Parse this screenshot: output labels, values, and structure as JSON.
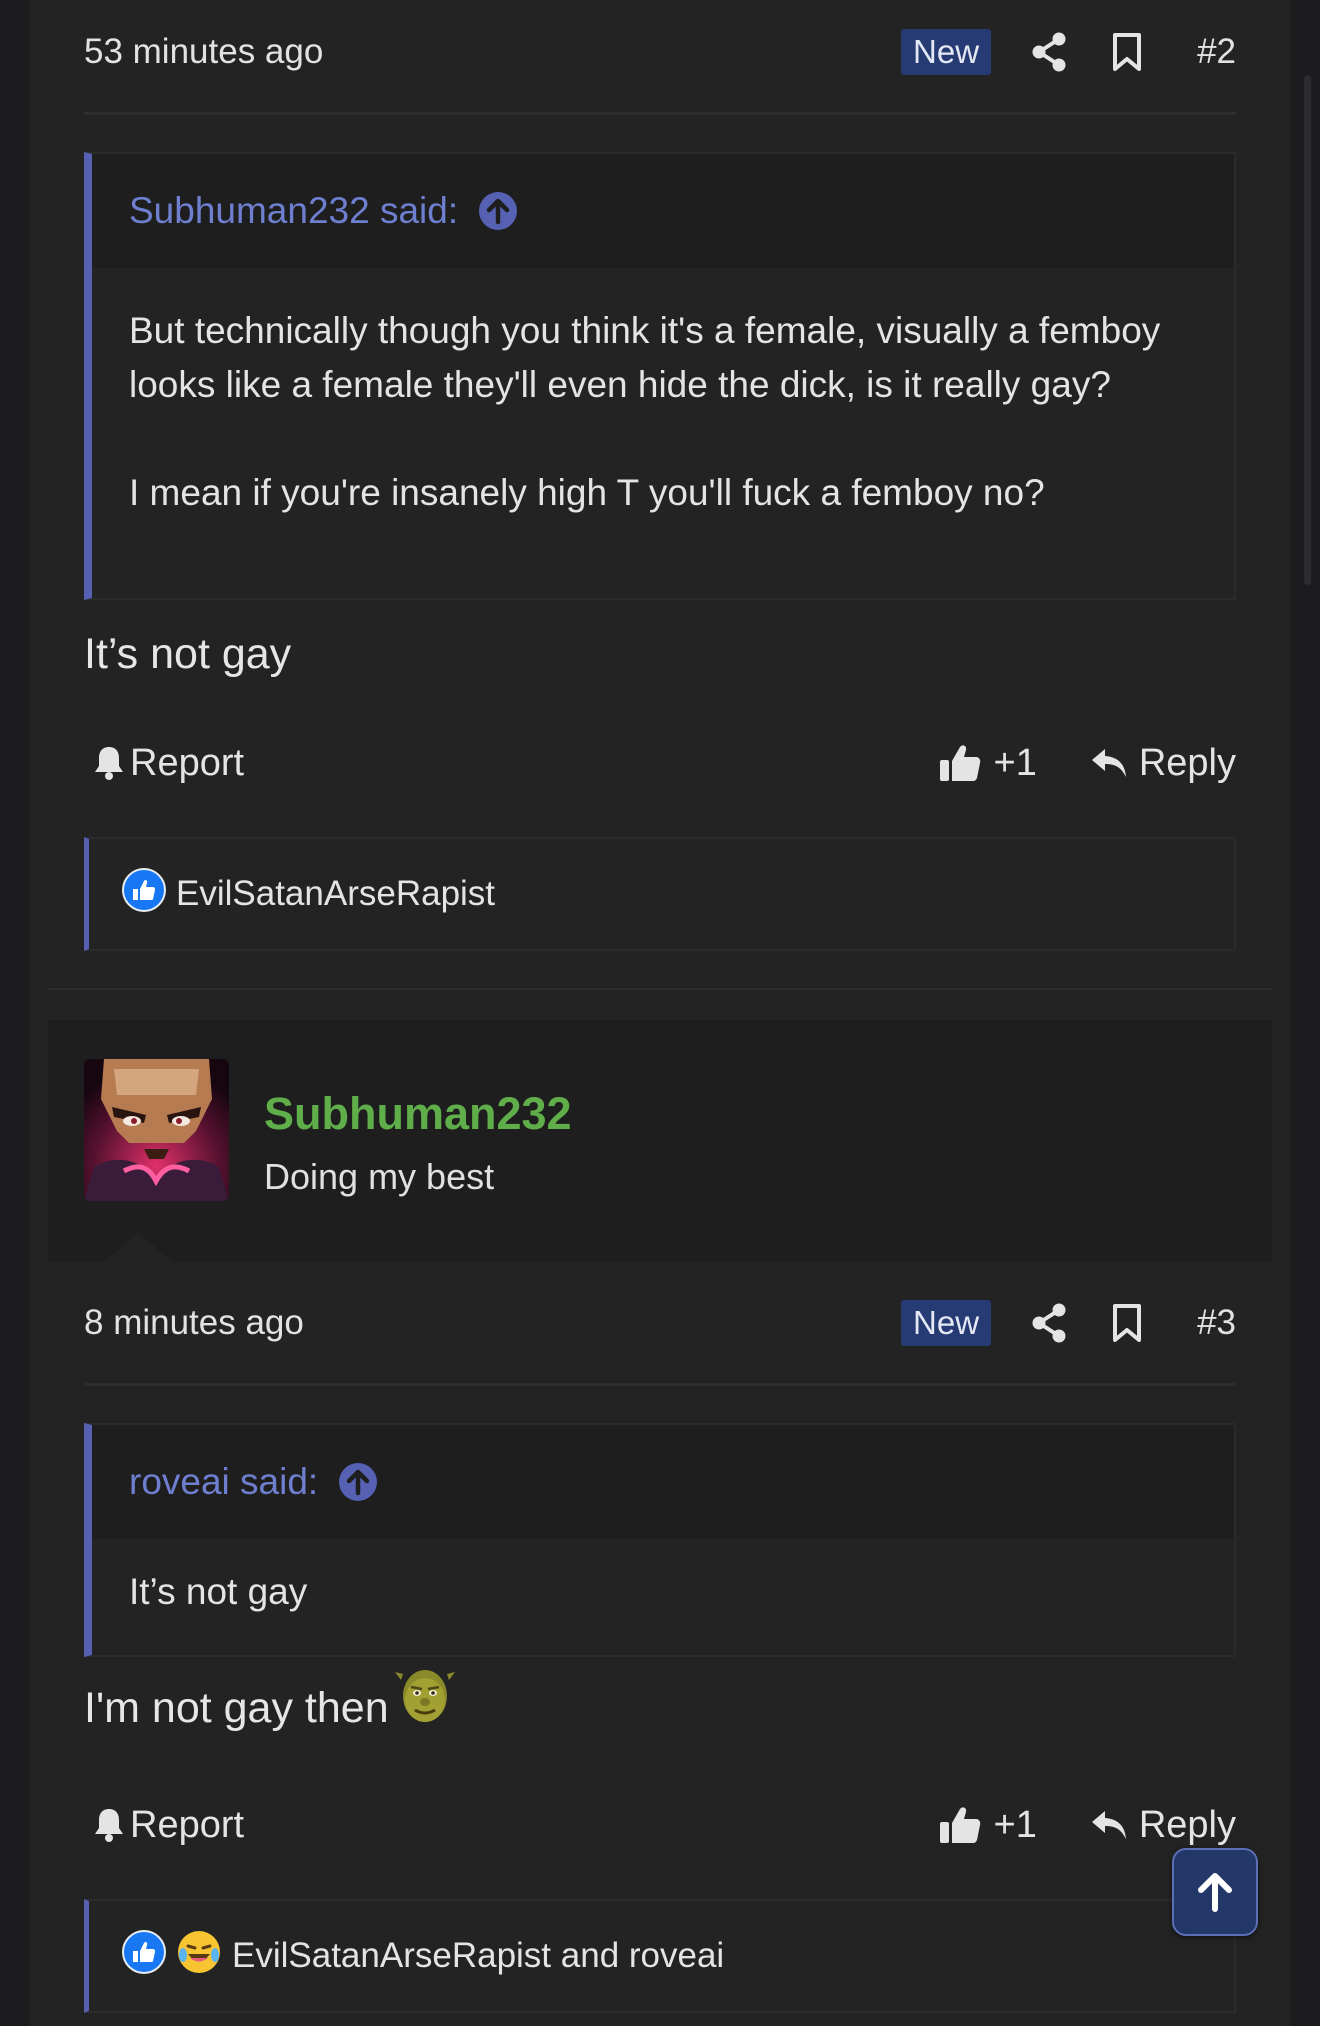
{
  "posts": [
    {
      "time": "53 minutes ago",
      "badge": "New",
      "number": "#2",
      "quote": {
        "author": "Subhuman232 said:",
        "paragraphs": [
          "But technically though you think it's a female, visually a femboy looks like a female they'll even hide the dick, is it really gay?",
          "I mean if you're insanely high T you'll fuck a femboy no?"
        ]
      },
      "message": "It’s not gay",
      "report_label": "Report",
      "like_count": "+1",
      "reply_label": "Reply",
      "reactions": "EvilSatanArseRapist",
      "reaction_icons": [
        "like-reaction-icon"
      ]
    },
    {
      "time": "8 minutes ago",
      "badge": "New",
      "number": "#3",
      "author": {
        "name": "Subhuman232",
        "title": "Doing my best"
      },
      "quote": {
        "author": "roveai said:",
        "paragraphs": [
          "It’s not gay"
        ]
      },
      "message": "I'm not gay then",
      "message_emoji": "shrek-emoji",
      "report_label": "Report",
      "like_count": "+1",
      "reply_label": "Reply",
      "reactions": "EvilSatanArseRapist and roveai",
      "reaction_icons": [
        "like-reaction-icon",
        "laugh-cry-reaction-icon"
      ]
    }
  ],
  "colors": {
    "accent": "#5661b3",
    "badge_bg": "#263b74",
    "username": "#5fae4a",
    "quote_author": "#6f7fd0"
  }
}
